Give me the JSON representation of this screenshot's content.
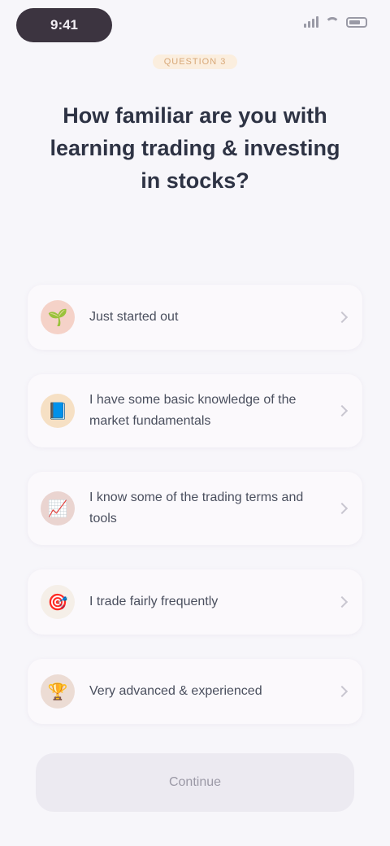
{
  "status": {
    "time": "9:41"
  },
  "eyebrow": "QUESTION 3",
  "question": "How familiar are you with learning trading & investing in stocks?",
  "options": [
    {
      "label": "Just started out",
      "icon": "seedling-icon",
      "icon_bg": "#f5d2c8",
      "glyph": "🌱"
    },
    {
      "label": "I have some basic knowledge of the market fundamentals",
      "icon": "book-icon",
      "icon_bg": "#f6e0c4",
      "glyph": "📘"
    },
    {
      "label": "I know some of the trading terms and tools",
      "icon": "chart-icon",
      "icon_bg": "#ead4d0",
      "glyph": "📈"
    },
    {
      "label": "I trade fairly frequently",
      "icon": "target-icon",
      "icon_bg": "#f5efe8",
      "glyph": "🎯"
    },
    {
      "label": "Very advanced & experienced",
      "icon": "trophy-icon",
      "icon_bg": "#ecdcd4",
      "glyph": "🏆"
    }
  ],
  "cta_label": "Continue",
  "colors": {
    "background": "#f7f6fa",
    "accent": "#d8a878",
    "text": "#2e3344"
  }
}
